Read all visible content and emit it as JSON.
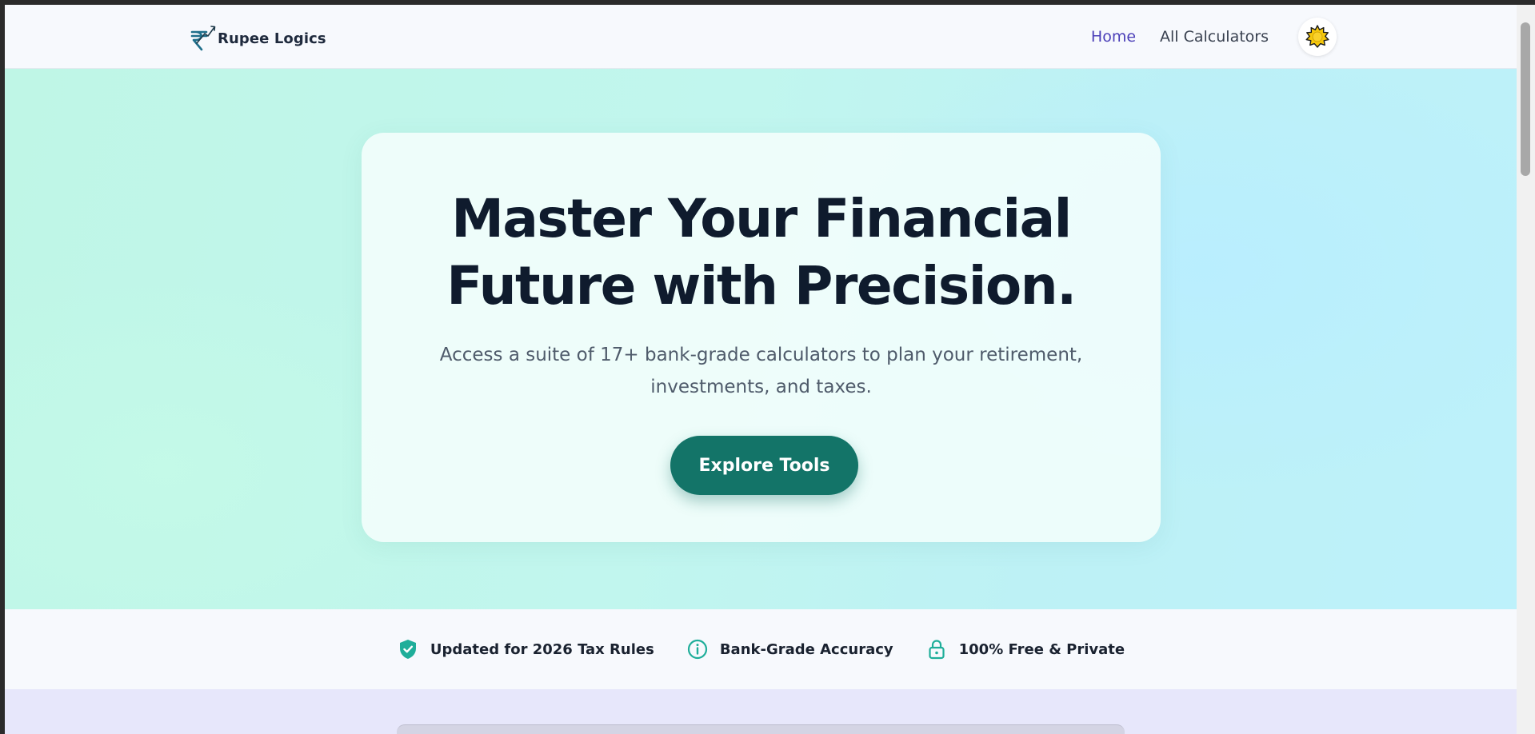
{
  "navbar": {
    "brand": "Rupee Logics",
    "links": [
      {
        "label": "Home",
        "active": true
      },
      {
        "label": "All Calculators",
        "active": false
      }
    ],
    "theme_toggle_icon": "sun-icon"
  },
  "hero": {
    "title_line1": "Master Your Financial",
    "title_line2": "Future with Precision.",
    "subtitle": "Access a suite of 17+ bank-grade calculators to plan your retirement, investments, and taxes.",
    "cta_label": "Explore Tools"
  },
  "features": [
    {
      "icon": "shield-check-icon",
      "label": "Updated for 2026 Tax Rules"
    },
    {
      "icon": "info-icon",
      "label": "Bank-Grade Accuracy"
    },
    {
      "icon": "lock-icon",
      "label": "100% Free & Private"
    }
  ],
  "colors": {
    "accent": "#137468",
    "nav_active": "#4b3fb8",
    "title": "#0f1b2d",
    "feature_icon": "#1fae9a"
  }
}
